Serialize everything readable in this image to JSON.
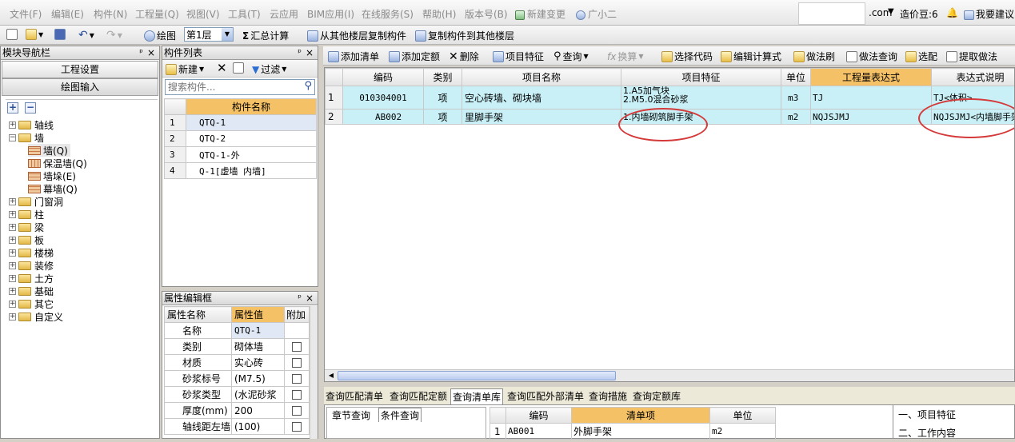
{
  "menu": {
    "items": [
      "文件(F)",
      "编辑(E)",
      "构件(N)",
      "工程量(Q)",
      "视图(V)",
      "工具(T)",
      "云应用",
      "BIM应用(I)",
      "在线服务(S)",
      "帮助(H)",
      "版本号(B)",
      "新建变更",
      "广小二"
    ],
    "domain_suffix": ".com",
    "price_beans": "造价豆:6",
    "suggest": "我要建议"
  },
  "toolbar": {
    "draw": "绘图",
    "floor": "第1层",
    "sum": "汇总计算",
    "copy_from": "从其他楼层复制构件",
    "copy_to": "复制构件到其他楼层"
  },
  "nav": {
    "title": "模块导航栏",
    "btn_project": "工程设置",
    "btn_draw": "绘图输入",
    "tree": [
      "轴线",
      "墙",
      "墙(Q)",
      "保温墙(Q)",
      "墙垛(E)",
      "幕墙(Q)",
      "门窗洞",
      "柱",
      "梁",
      "板",
      "楼梯",
      "装修",
      "土方",
      "基础",
      "其它",
      "自定义"
    ]
  },
  "comp_list": {
    "title": "构件列表",
    "new": "新建",
    "filter": "过滤",
    "search_placeholder": "搜索构件...",
    "col_name": "构件名称",
    "rows": [
      {
        "no": "1",
        "name": "QTQ-1"
      },
      {
        "no": "2",
        "name": "QTQ-2"
      },
      {
        "no": "3",
        "name": "QTQ-1-外"
      },
      {
        "no": "4",
        "name": "Q-1[虚墙 内墙]"
      }
    ]
  },
  "props": {
    "title": "属性编辑框",
    "col_name": "属性名称",
    "col_value": "属性值",
    "col_extra": "附加",
    "rows": [
      {
        "name": "名称",
        "value": "QTQ-1"
      },
      {
        "name": "类别",
        "value": "砌体墙"
      },
      {
        "name": "材质",
        "value": "实心砖"
      },
      {
        "name": "砂浆标号",
        "value": "(M7.5)"
      },
      {
        "name": "砂浆类型",
        "value": "(水泥砂浆"
      },
      {
        "name": "厚度(mm)",
        "value": "200"
      },
      {
        "name": "轴线距左墙",
        "value": "(100)"
      }
    ]
  },
  "quota_toolbar": {
    "add_list": "添加清单",
    "add_quota": "添加定额",
    "delete": "删除",
    "feature": "项目特征",
    "query": "查询",
    "convert": "换算",
    "select_code": "选择代码",
    "edit_formula": "编辑计算式",
    "method_brush": "做法刷",
    "method_query": "做法查询",
    "match": "选配",
    "extract": "提取做法"
  },
  "grid": {
    "headers": [
      "编码",
      "类别",
      "项目名称",
      "项目特征",
      "单位",
      "工程量表达式",
      "表达式说明"
    ],
    "rows": [
      {
        "no": "1",
        "code": "010304001",
        "type": "项",
        "name": "空心砖墙、砌块墙",
        "feature1": "1.A5加气块",
        "feature2": "2.M5.0混合砂浆",
        "unit": "m3",
        "expr": "TJ",
        "desc": "TJ<体积>"
      },
      {
        "no": "2",
        "code": "AB002",
        "type": "项",
        "name": "里脚手架",
        "feature1": "1.内墙砌筑脚手架",
        "feature2": "",
        "unit": "m2",
        "expr": "NQJSJMJ",
        "desc": "NQJSJMJ<内墙脚手架"
      }
    ]
  },
  "bottom": {
    "tabs": [
      "查询匹配清单",
      "查询匹配定额",
      "查询清单库",
      "查询匹配外部清单",
      "查询措施",
      "查询定额库"
    ],
    "subtabs": [
      "章节查询",
      "条件查询"
    ],
    "table_headers": [
      "编码",
      "清单项",
      "单位"
    ],
    "row": {
      "no": "1",
      "code": "AB001",
      "item": "外脚手架",
      "unit": "m2"
    },
    "right_items": [
      "一、项目特征",
      "二、工作内容"
    ]
  }
}
